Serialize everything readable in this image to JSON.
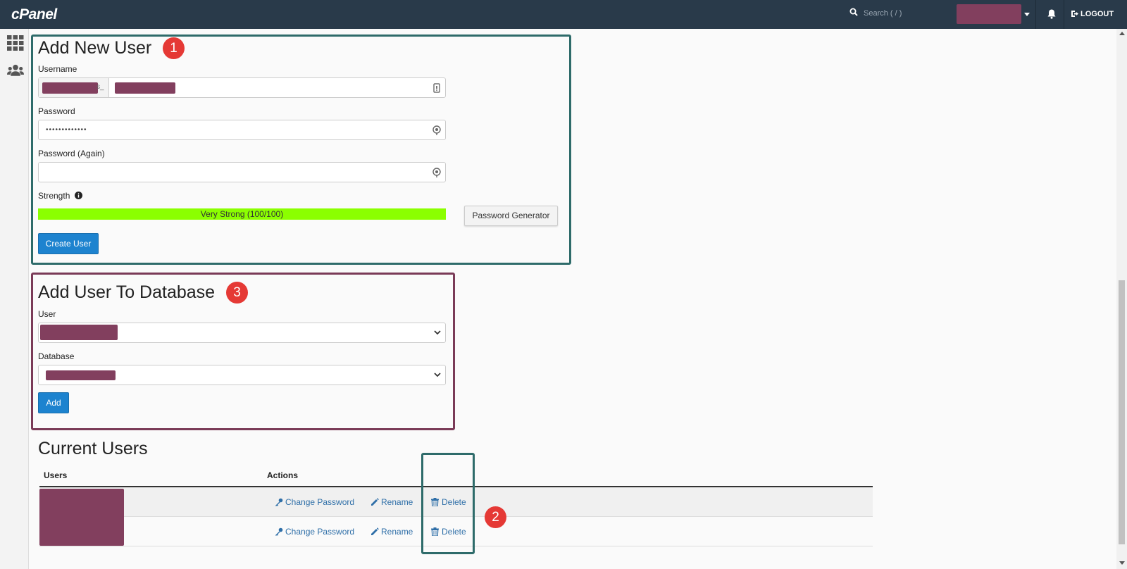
{
  "app": {
    "logo": "cPanel"
  },
  "header": {
    "search_placeholder": "Search ( / )",
    "logout_label": "LOGOUT"
  },
  "add_user": {
    "title": "Add New User",
    "badge": "1",
    "username_label": "Username",
    "username_prefix": "s_",
    "password_label": "Password",
    "password_value": "•••••••••••••",
    "password_again_label": "Password (Again)",
    "strength_label": "Strength",
    "strength_text": "Very Strong (100/100)",
    "strength_score": 100,
    "generator_button": "Password Generator",
    "create_button": "Create User"
  },
  "add_to_db": {
    "title": "Add User To Database",
    "badge": "3",
    "user_label": "User",
    "database_label": "Database",
    "add_button": "Add"
  },
  "current_users": {
    "title": "Current Users",
    "columns": [
      "Users",
      "Actions"
    ],
    "badge": "2",
    "rows": [
      {
        "change_password": "Change Password",
        "rename": "Rename",
        "delete": "Delete"
      },
      {
        "change_password": "Change Password",
        "rename": "Rename",
        "delete": "Delete"
      }
    ]
  },
  "colors": {
    "topbar": "#293a4a",
    "primary": "#1d83cf",
    "strength": "#8bff00",
    "redaction": "#823f5e",
    "frame_teal": "#2e6b6a",
    "frame_plum": "#7a3a57",
    "badge": "#e53935"
  }
}
